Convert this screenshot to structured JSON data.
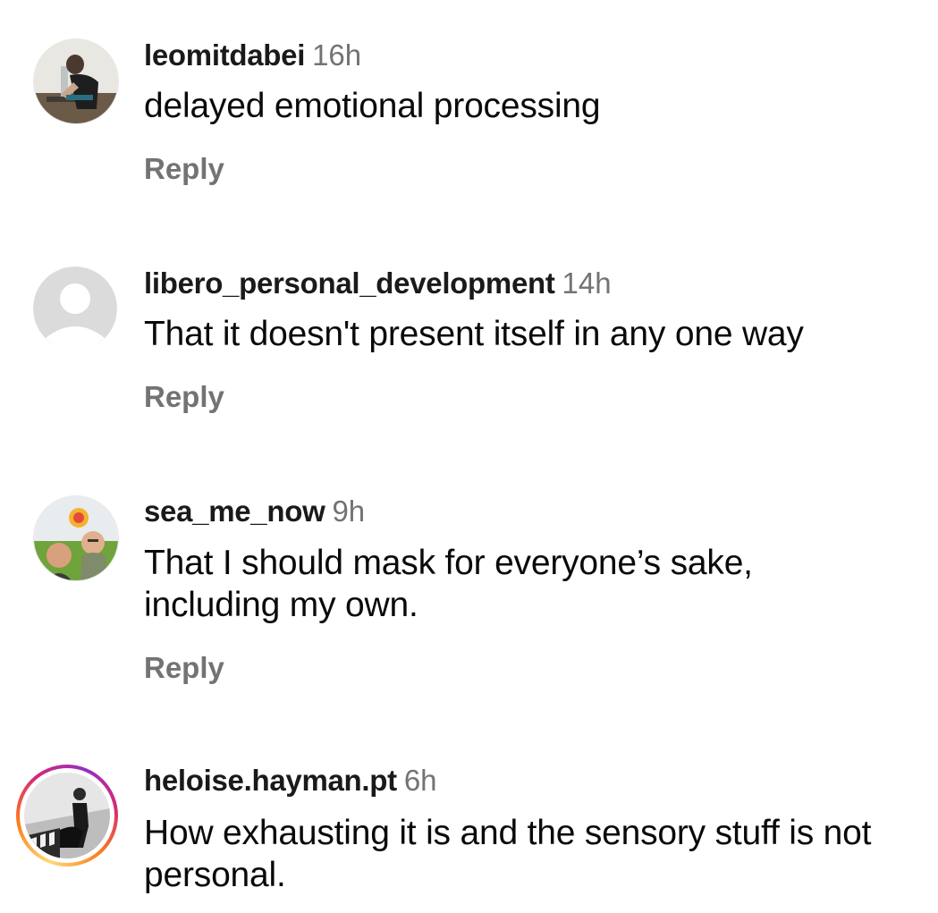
{
  "comments": [
    {
      "username": "leomitdabei",
      "time": "16h",
      "text": "delayed emotional processing",
      "reply_label": "Reply",
      "avatar_icon": "photo-avatar"
    },
    {
      "username": "libero_personal_development",
      "time": "14h",
      "text": "That it doesn't present itself in any one way",
      "reply_label": "Reply",
      "avatar_icon": "default-person-avatar"
    },
    {
      "username": "sea_me_now",
      "time": "9h",
      "text": "That I should mask for everyone’s sake, including my own.",
      "reply_label": "Reply",
      "avatar_icon": "photo-avatar"
    },
    {
      "username": "heloise.hayman.pt",
      "time": "6h",
      "text": "How exhausting it is and the sensory stuff is not personal.",
      "avatar_icon": "photo-avatar-story-ring"
    }
  ],
  "colors": {
    "secondary_text": "#737373",
    "primary_text": "#0a0a0a",
    "placeholder_avatar_bg": "#dbdbdb"
  }
}
